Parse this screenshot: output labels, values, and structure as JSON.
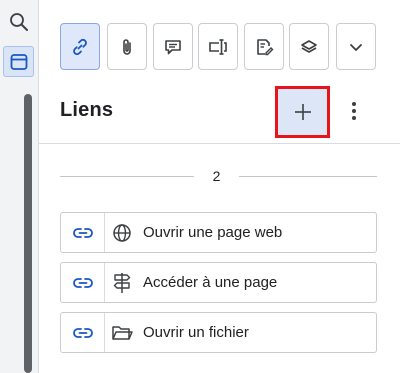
{
  "rail": {
    "items": [
      {
        "name": "search",
        "icon": "search-icon"
      },
      {
        "name": "panel",
        "icon": "panel-icon",
        "active": true
      }
    ]
  },
  "toolbar": {
    "buttons": [
      {
        "icon": "link-icon",
        "active": true
      },
      {
        "icon": "paperclip-icon",
        "active": false
      },
      {
        "icon": "comment-icon",
        "active": false
      },
      {
        "icon": "text-field-icon",
        "active": false
      },
      {
        "icon": "signature-icon",
        "active": false
      },
      {
        "icon": "layers-icon",
        "active": false
      },
      {
        "icon": "chevron-down-icon",
        "active": false
      }
    ]
  },
  "header": {
    "title": "Liens",
    "add_icon": "plus-icon",
    "more_icon": "more-vertical-icon"
  },
  "separator": {
    "page_number": "2"
  },
  "links": [
    {
      "label": "Ouvrir une page web",
      "icon": "globe-icon"
    },
    {
      "label": "Accéder à une page",
      "icon": "signpost-icon"
    },
    {
      "label": "Ouvrir un fichier",
      "icon": "folder-icon"
    }
  ],
  "colors": {
    "accent": "#1a56c4",
    "active_bg": "#dfe8fb",
    "highlight_border": "#e8141b"
  }
}
